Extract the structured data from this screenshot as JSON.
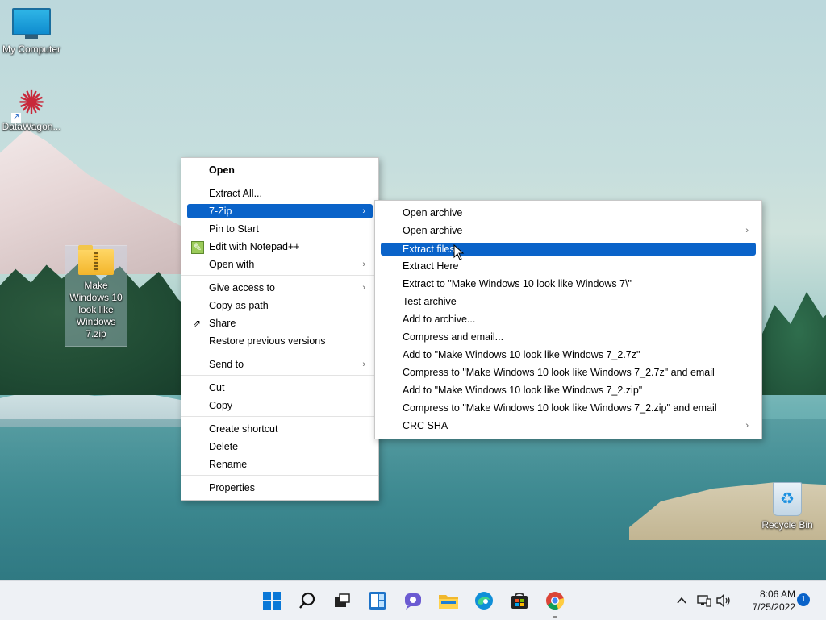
{
  "desktop": {
    "icons": {
      "my_computer": "My Computer",
      "datawagon": "DataWagon...",
      "zip_file": "Make Windows 10 look like Windows 7.zip",
      "recycle_bin": "Recycle Bin"
    }
  },
  "context_menu": {
    "items": [
      {
        "label": "Open"
      },
      {
        "label": "Extract All..."
      },
      {
        "label": "7-Zip"
      },
      {
        "label": "Pin to Start"
      },
      {
        "label": "Edit with Notepad++"
      },
      {
        "label": "Open with"
      },
      {
        "label": "Give access to"
      },
      {
        "label": "Copy as path"
      },
      {
        "label": "Share"
      },
      {
        "label": "Restore previous versions"
      },
      {
        "label": "Send to"
      },
      {
        "label": "Cut"
      },
      {
        "label": "Copy"
      },
      {
        "label": "Create shortcut"
      },
      {
        "label": "Delete"
      },
      {
        "label": "Rename"
      },
      {
        "label": "Properties"
      }
    ],
    "highlighted": "7-Zip"
  },
  "submenu_7zip": {
    "items": [
      {
        "label": "Open archive"
      },
      {
        "label": "Open archive"
      },
      {
        "label": "Extract files..."
      },
      {
        "label": "Extract Here"
      },
      {
        "label": "Extract to \"Make Windows 10 look like Windows 7\\\""
      },
      {
        "label": "Test archive"
      },
      {
        "label": "Add to archive..."
      },
      {
        "label": "Compress and email..."
      },
      {
        "label": "Add to \"Make Windows 10 look like Windows 7_2.7z\""
      },
      {
        "label": "Compress to \"Make Windows 10 look like Windows 7_2.7z\" and email"
      },
      {
        "label": "Add to \"Make Windows 10 look like Windows 7_2.zip\""
      },
      {
        "label": "Compress to \"Make Windows 10 look like Windows 7_2.zip\" and email"
      },
      {
        "label": "CRC SHA"
      }
    ],
    "highlighted": "Extract files..."
  },
  "taskbar": {
    "apps": [
      "start-icon",
      "search-icon",
      "task-view-icon",
      "widgets-icon",
      "chat-icon",
      "file-explorer-icon",
      "edge-icon",
      "store-icon",
      "chrome-icon"
    ],
    "clock": {
      "time": "8:06 AM",
      "date": "7/25/2022"
    },
    "notification_count": "1"
  },
  "colors": {
    "highlight": "#0a63c9",
    "taskbar": "#eef1f5"
  }
}
